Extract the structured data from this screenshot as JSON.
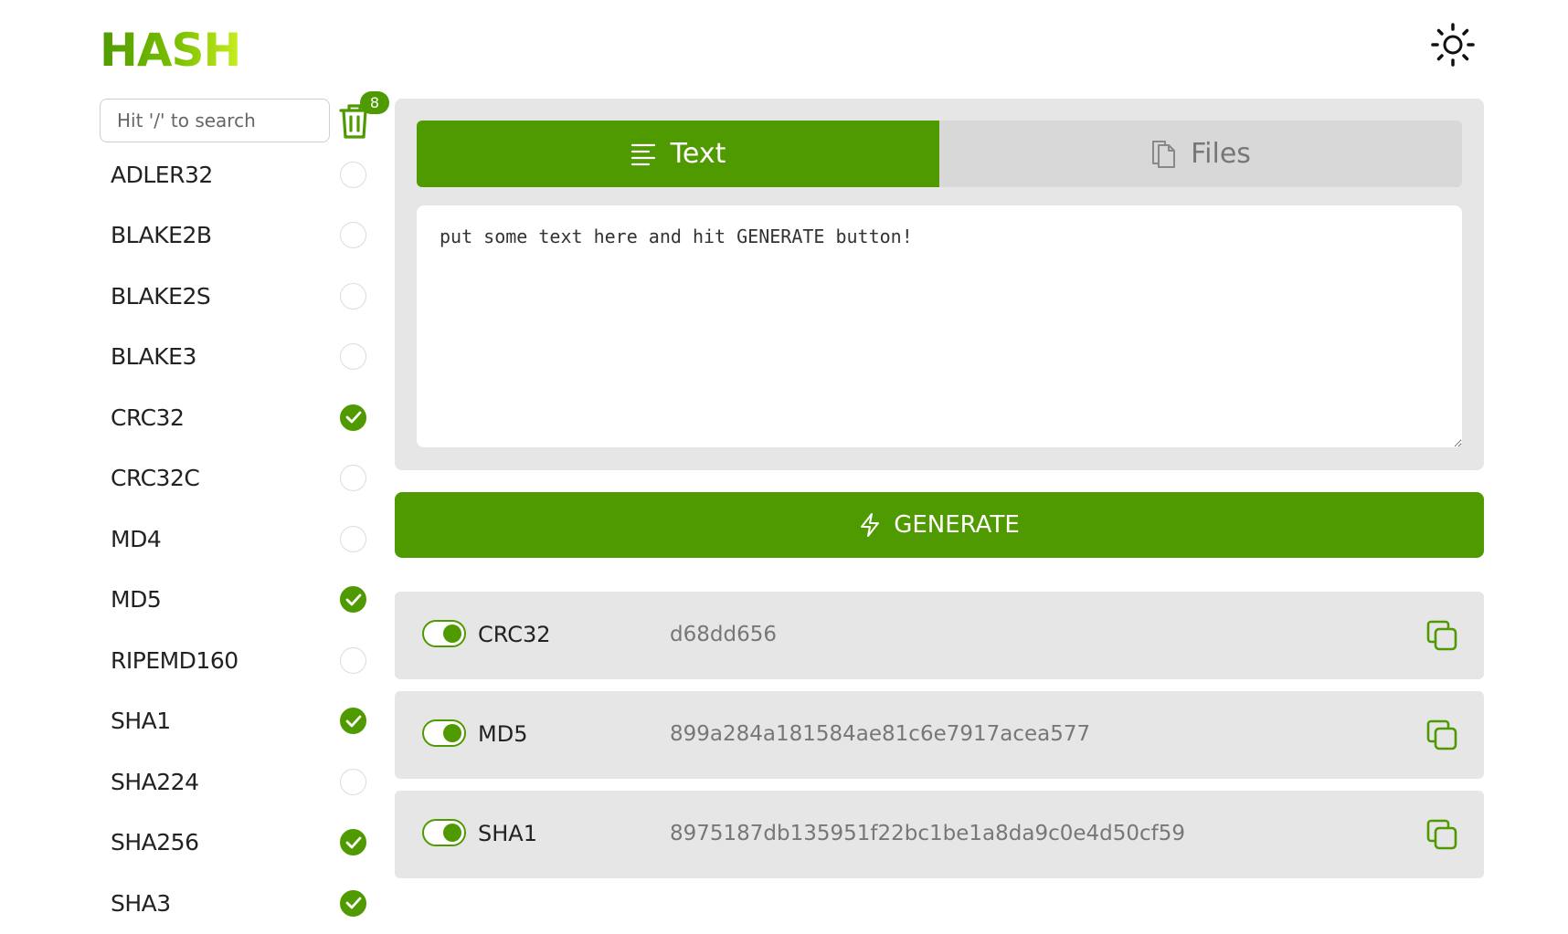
{
  "app": {
    "logo_text": "HASH"
  },
  "theme_toggle": {
    "icon": "sun-icon"
  },
  "search": {
    "placeholder": "Hit '/' to search"
  },
  "trash": {
    "icon": "trash-icon",
    "badge_count": "8"
  },
  "algorithms": [
    {
      "label": "ADLER32",
      "checked": false
    },
    {
      "label": "BLAKE2B",
      "checked": false
    },
    {
      "label": "BLAKE2S",
      "checked": false
    },
    {
      "label": "BLAKE3",
      "checked": false
    },
    {
      "label": "CRC32",
      "checked": true
    },
    {
      "label": "CRC32C",
      "checked": false
    },
    {
      "label": "MD4",
      "checked": false
    },
    {
      "label": "MD5",
      "checked": true
    },
    {
      "label": "RIPEMD160",
      "checked": false
    },
    {
      "label": "SHA1",
      "checked": true
    },
    {
      "label": "SHA224",
      "checked": false
    },
    {
      "label": "SHA256",
      "checked": true
    },
    {
      "label": "SHA3",
      "checked": true
    }
  ],
  "tabs": [
    {
      "label": "Text",
      "icon": "text-lines-icon",
      "active": true
    },
    {
      "label": "Files",
      "icon": "files-icon",
      "active": false
    }
  ],
  "input": {
    "placeholder": "put some text here and hit GENERATE button!"
  },
  "generate": {
    "label": "GENERATE",
    "icon": "lightning-icon"
  },
  "results": [
    {
      "name": "CRC32",
      "hash": "d68dd656",
      "enabled": true
    },
    {
      "name": "MD5",
      "hash": "899a284a181584ae81c6e7917acea577",
      "enabled": true
    },
    {
      "name": "SHA1",
      "hash": "8975187db135951f22bc1be1a8da9c0e4d50cf59",
      "enabled": true
    }
  ],
  "colors": {
    "accent": "#4f9a00",
    "panel": "#e6e6e6",
    "tab_inactive": "#d8d8d8"
  }
}
